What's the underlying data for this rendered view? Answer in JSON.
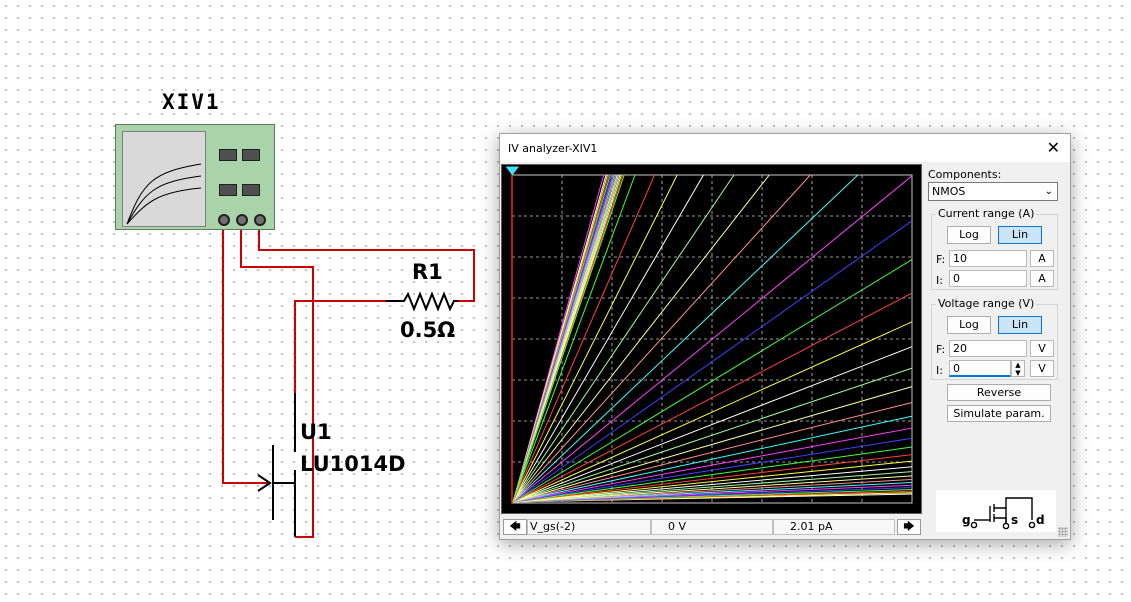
{
  "schematic": {
    "instrument_label": "XIV1",
    "resistor_name": "R1",
    "resistor_value": "0.5Ω",
    "transistor_name": "U1",
    "transistor_part": "LU1014D",
    "wire_color": "#cc0000"
  },
  "dialog": {
    "title": "IV analyzer-XIV1",
    "close_glyph": "✕",
    "status": {
      "left_arrow": "🡄",
      "right_arrow": "🡆",
      "param": "V_gs(-2)",
      "voltage": "0  V",
      "current": "2.01 pA"
    },
    "components_label": "Components:",
    "component_selected": "NMOS",
    "current_range": {
      "title": "Current range (A)",
      "log_label": "Log",
      "lin_label": "Lin",
      "f_label": "F:",
      "f_value": "10",
      "f_unit": "A",
      "i_label": "I:",
      "i_value": "0",
      "i_unit": "A"
    },
    "voltage_range": {
      "title": "Voltage range (V)",
      "log_label": "Log",
      "lin_label": "Lin",
      "f_label": "F:",
      "f_value": "20",
      "f_unit": "V",
      "i_label": "I:",
      "i_value": "0",
      "i_unit": "V"
    },
    "reverse_label": "Reverse",
    "simulate_label": "Simulate param.",
    "device_pins": {
      "g": "g",
      "s": "s",
      "d": "d"
    }
  },
  "plot": {
    "background": "#000000",
    "grid_color": "#c8c8c8",
    "cursor_color": "#ff2020",
    "curve_colors": [
      "#ffffff",
      "#ffff40",
      "#ff4040",
      "#40ff40",
      "#4040ff",
      "#ff40ff",
      "#40ffff",
      "#ff9090",
      "#ffffa0",
      "#a0ffa0"
    ],
    "curve_count": 36
  }
}
